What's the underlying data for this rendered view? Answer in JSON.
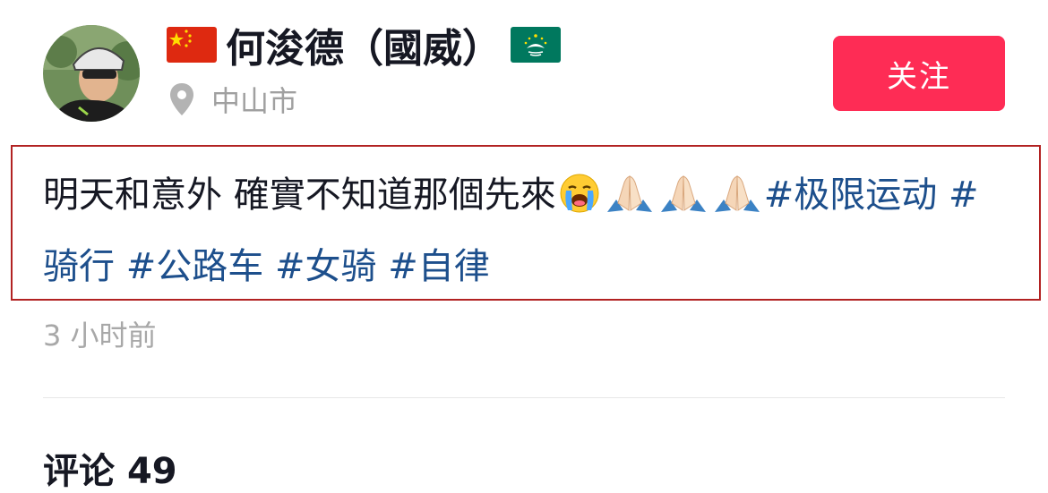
{
  "author": {
    "name": "何浚德（國威）",
    "avatar_icon": "cyclist-avatar",
    "flag_left_icon": "china-flag-icon",
    "flag_right_icon": "macau-flag-icon",
    "location": "中山市",
    "location_icon": "location-pin-icon"
  },
  "follow_button": {
    "label": "关注",
    "color": "#fe2c55"
  },
  "post": {
    "caption_text": "明天和意外 確實不知道那個先來",
    "emojis": [
      "crying-face-emoji",
      "folded-hands-emoji",
      "folded-hands-emoji",
      "folded-hands-emoji"
    ],
    "hashtags": [
      "#极限运动",
      "#骑行",
      "#公路车",
      "#女骑",
      "#自律"
    ],
    "hashtag_color": "#1d4f8c",
    "timestamp": "3 小时前"
  },
  "comments": {
    "label": "评论",
    "count": "49"
  },
  "highlight_color": "#b22222"
}
